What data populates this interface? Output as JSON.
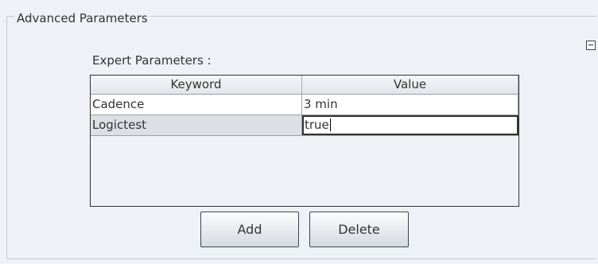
{
  "group": {
    "title": "Advanced Parameters"
  },
  "section": {
    "label": "Expert Parameters :"
  },
  "table": {
    "headers": [
      "Keyword",
      "Value"
    ],
    "rows": [
      {
        "keyword": "Cadence",
        "value": "3 min"
      },
      {
        "keyword": "Logictest",
        "value": "true"
      }
    ]
  },
  "buttons": {
    "add_label": "Add",
    "delete_label": "Delete"
  },
  "icons": {
    "collapse": "collapse-icon"
  }
}
